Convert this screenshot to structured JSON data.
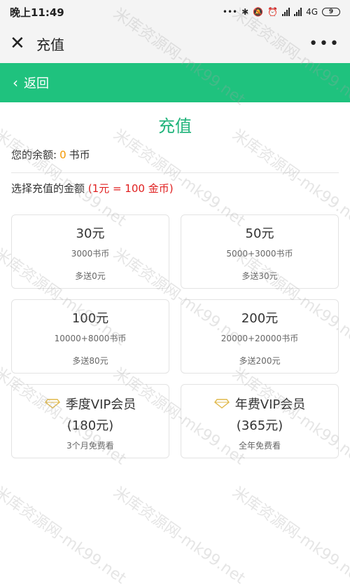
{
  "status": {
    "time": "晚上11:49",
    "dots": "•••",
    "net": "4G",
    "battery": "9"
  },
  "appbar": {
    "title": "充值",
    "more": "•••"
  },
  "nav": {
    "back": "返回"
  },
  "page": {
    "heading": "充值",
    "balance_label": "您的余额:",
    "balance_value": "0",
    "balance_unit": "书币",
    "choose_label": "选择充值的金额",
    "choose_rate": "(1元 = 100 金币)"
  },
  "options": [
    {
      "title": "30元",
      "sub": "3000书币",
      "bonus": "多送0元"
    },
    {
      "title": "50元",
      "sub": "5000+3000书币",
      "bonus": "多送30元"
    },
    {
      "title": "100元",
      "sub": "10000+8000书币",
      "bonus": "多送80元"
    },
    {
      "title": "200元",
      "sub": "20000+20000书币",
      "bonus": "多送200元"
    }
  ],
  "vip": [
    {
      "title": "季度VIP会员",
      "price": "(180元)",
      "note": "3个月免费看"
    },
    {
      "title": "年费VIP会员",
      "price": "(365元)",
      "note": "全年免费看"
    }
  ],
  "watermark": "米库资源网-mk99.net",
  "colors": {
    "accent": "#1fc27e",
    "heading": "#1fb37a",
    "balance": "#f39800",
    "rate": "#e02020"
  }
}
